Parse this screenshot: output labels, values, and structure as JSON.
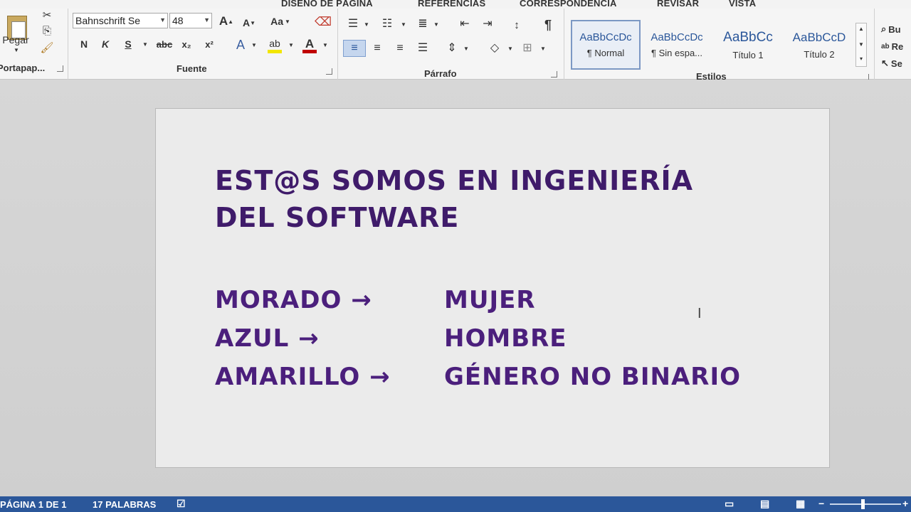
{
  "tabs": [
    "DISEÑO DE PÁGINA",
    "REFERENCIAS",
    "CORRESPONDENCIA",
    "REVISAR",
    "VISTA"
  ],
  "clipboard": {
    "paste_label": "Pegar",
    "group_label": "Portapap..."
  },
  "font": {
    "name": "Bahnschrift Se",
    "size": "48",
    "grow": "A",
    "shrink": "A",
    "case": "Aa",
    "bold": "N",
    "italic": "K",
    "underline": "S",
    "strike": "abc",
    "subscript": "x₂",
    "superscript": "x²",
    "group_label": "Fuente"
  },
  "paragraph": {
    "group_label": "Párrafo",
    "pilcrow": "¶"
  },
  "styles": {
    "group_label": "Estilos",
    "items": [
      {
        "sample": "AaBbCcDc",
        "name": "¶ Normal"
      },
      {
        "sample": "AaBbCcDc",
        "name": "¶ Sin espa..."
      },
      {
        "sample": "AaBbCc",
        "name": "Título 1"
      },
      {
        "sample": "AaBbCcD",
        "name": "Título 2"
      }
    ]
  },
  "editing": {
    "find": "Bu",
    "replace": "Re",
    "select": "Se"
  },
  "document": {
    "title_line1": "EST@S SOMOS EN INGENIERÍA",
    "title_line2": "DEL SOFTWARE",
    "rows": [
      {
        "left": "MORADO →",
        "right": "MUJER"
      },
      {
        "left": "AZUL →",
        "right": "HOMBRE"
      },
      {
        "left": "AMARILLO →",
        "right": "GÉNERO NO BINARIO"
      }
    ]
  },
  "status": {
    "page": "PÁGINA 1 DE 1",
    "words": "17 PALABRAS"
  },
  "colors": {
    "accent": "#2b579a",
    "text_purple": "#4b1f7c",
    "highlight": "#f2e600",
    "font_color": "#c00000"
  }
}
